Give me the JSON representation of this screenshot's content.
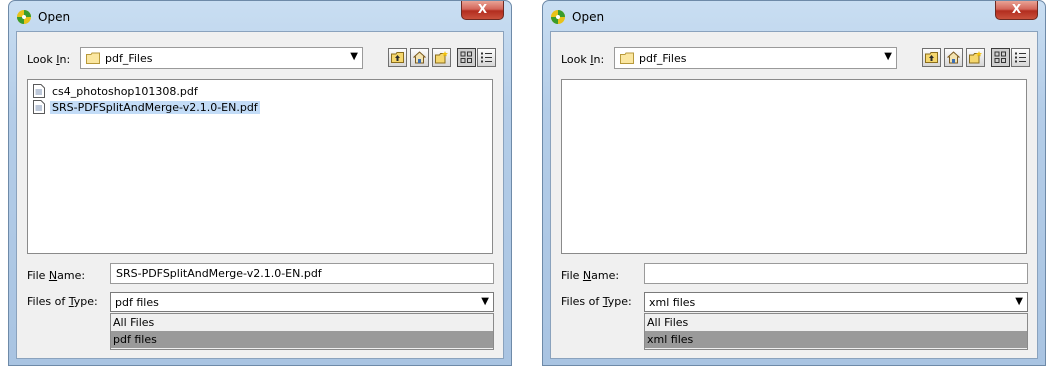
{
  "dialogs": [
    {
      "title": "Open",
      "close_label": "X",
      "look_in_label": "Look In:",
      "look_in_value": "pdf_Files",
      "files": [
        {
          "name": "cs4_photoshop101308.pdf",
          "selected": false
        },
        {
          "name": "SRS-PDFSplitAndMerge-v2.1.0-EN.pdf",
          "selected": true
        }
      ],
      "file_name_label": "File Name:",
      "file_name_value": "SRS-PDFSplitAndMerge-v2.1.0-EN.pdf",
      "files_of_type_label": "Files of Type:",
      "files_of_type_value": "pdf files",
      "type_options": [
        "All Files",
        "pdf files"
      ],
      "selected_option": 1
    },
    {
      "title": "Open",
      "close_label": "X",
      "look_in_label": "Look In:",
      "look_in_value": "pdf_Files",
      "files": [],
      "file_name_label": "File Name:",
      "file_name_value": "",
      "files_of_type_label": "Files of Type:",
      "files_of_type_value": "xml files",
      "type_options": [
        "All Files",
        "xml files"
      ],
      "selected_option": 1
    }
  ],
  "icons": {
    "app": "green-yellow-swirl-icon",
    "folder": "folder-icon",
    "file": "document-icon",
    "up": "up-folder-icon",
    "home": "home-icon",
    "new_folder": "new-folder-icon",
    "list_view": "list-view-icon",
    "details_view": "details-view-icon"
  },
  "colors": {
    "selection": "#c3dcf7",
    "dropdown_selected": "#9a9a9a",
    "close_button": "#c9503c"
  }
}
